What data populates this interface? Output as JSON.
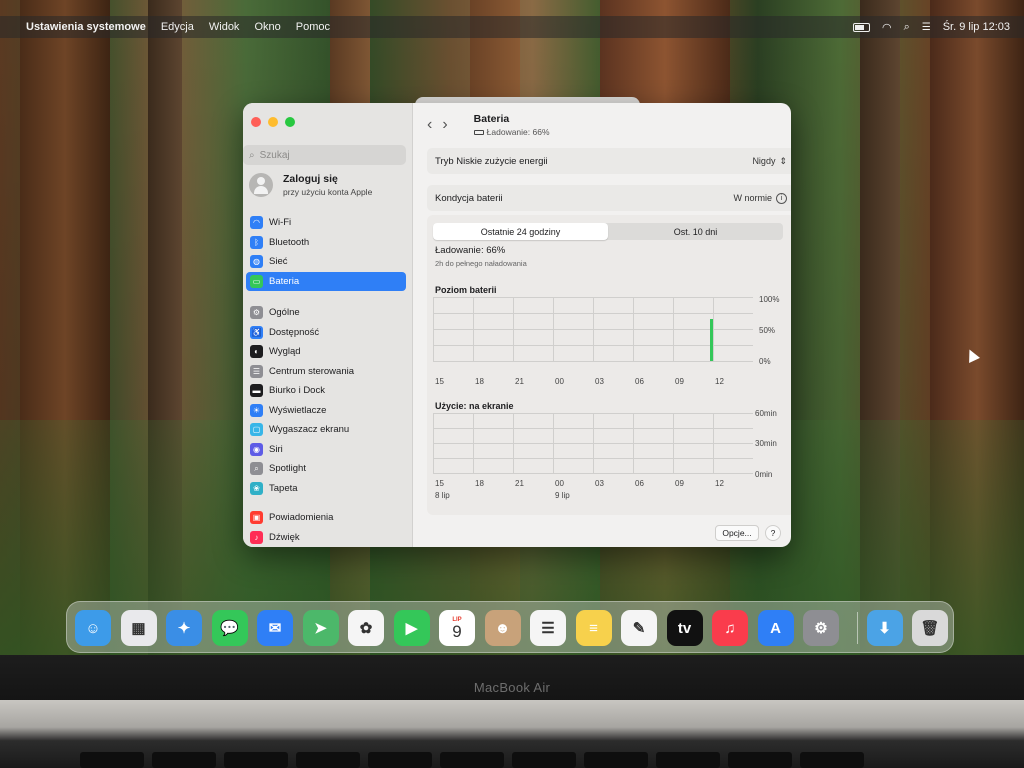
{
  "menubar": {
    "app": "Ustawienia systemowe",
    "items": [
      "Edycja",
      "Widok",
      "Okno",
      "Pomoc"
    ],
    "clock": "Śr. 9 lip  12:03"
  },
  "sidebar": {
    "search_placeholder": "Szukaj",
    "login_title": "Zaloguj się",
    "login_sub": "przy użyciu konta Apple",
    "items": [
      {
        "label": "Wi‑Fi",
        "color": "#2f7ff6",
        "icon": "wifi-icon"
      },
      {
        "label": "Bluetooth",
        "color": "#2f7ff6",
        "icon": "bluetooth-icon"
      },
      {
        "label": "Sieć",
        "color": "#2f7ff6",
        "icon": "globe-icon"
      },
      {
        "label": "Bateria",
        "color": "#34c759",
        "icon": "battery-icon"
      },
      {
        "label": "Ogólne",
        "color": "#8e8e93",
        "icon": "gear-icon"
      },
      {
        "label": "Dostępność",
        "color": "#2f7ff6",
        "icon": "accessibility-icon"
      },
      {
        "label": "Wygląd",
        "color": "#1d1d1f",
        "icon": "appearance-icon"
      },
      {
        "label": "Centrum sterowania",
        "color": "#8e8e93",
        "icon": "control-center-icon"
      },
      {
        "label": "Biurko i Dock",
        "color": "#1d1d1f",
        "icon": "dock-icon"
      },
      {
        "label": "Wyświetlacze",
        "color": "#2f7ff6",
        "icon": "sun-icon"
      },
      {
        "label": "Wygaszacz ekranu",
        "color": "#38b6e8",
        "icon": "screensaver-icon"
      },
      {
        "label": "Siri",
        "color": "#5e5ce6",
        "icon": "siri-icon"
      },
      {
        "label": "Spotlight",
        "color": "#8e8e93",
        "icon": "spotlight-icon"
      },
      {
        "label": "Tapeta",
        "color": "#30b0c7",
        "icon": "wallpaper-icon"
      },
      {
        "label": "Powiadomienia",
        "color": "#ff3b30",
        "icon": "notifications-icon"
      },
      {
        "label": "Dźwięk",
        "color": "#ff2d55",
        "icon": "sound-icon"
      }
    ],
    "active": "Bateria"
  },
  "content": {
    "title": "Bateria",
    "subtitle": "Ładowanie: 66%",
    "low_power_label": "Tryb Niskie zużycie energii",
    "low_power_value": "Nigdy",
    "health_label": "Kondycja baterii",
    "health_value": "W normie",
    "tab_24h": "Ostatnie 24 godziny",
    "tab_10d": "Ost. 10 dni",
    "charge_text": "Ładowanie: 66%",
    "charge_sub": "2h do pełnego naładowania",
    "battery_section": "Poziom baterii",
    "usage_section": "Użycie: na ekranie",
    "y_battery": [
      "100%",
      "50%",
      "0%"
    ],
    "y_usage": [
      "60min",
      "30min",
      "0min"
    ],
    "x_hours": [
      "15",
      "18",
      "21",
      "00",
      "03",
      "06",
      "09",
      "12"
    ],
    "x_days": [
      "8 lip",
      "9 lip"
    ],
    "options_button": "Opcje...",
    "help_button": "?",
    "battery_level_fraction": 0.66
  },
  "dock": {
    "apps": [
      {
        "name": "finder-icon",
        "color": "#3d9be9",
        "glyph": "☺"
      },
      {
        "name": "launchpad-icon",
        "color": "#e9e9ec",
        "glyph": "▦"
      },
      {
        "name": "safari-icon",
        "color": "#3a8ee6",
        "glyph": "✦"
      },
      {
        "name": "messages-icon",
        "color": "#34c759",
        "glyph": "💬"
      },
      {
        "name": "mail-icon",
        "color": "#2f7ff6",
        "glyph": "✉"
      },
      {
        "name": "maps-icon",
        "color": "#4cb86a",
        "glyph": "➤"
      },
      {
        "name": "photos-icon",
        "color": "#f5f5f5",
        "glyph": "✿"
      },
      {
        "name": "facetime-icon",
        "color": "#34c759",
        "glyph": "▶"
      },
      {
        "name": "calendar-icon",
        "color": "#ffffff",
        "glyph": ""
      },
      {
        "name": "contacts-icon",
        "color": "#c8a27a",
        "glyph": "☻"
      },
      {
        "name": "reminders-icon",
        "color": "#f5f5f5",
        "glyph": "☰"
      },
      {
        "name": "notes-icon",
        "color": "#f7d14c",
        "glyph": "≡"
      },
      {
        "name": "freeform-icon",
        "color": "#f5f5f5",
        "glyph": "✎"
      },
      {
        "name": "appletv-icon",
        "color": "#111111",
        "glyph": "tv"
      },
      {
        "name": "music-icon",
        "color": "#fa3c4c",
        "glyph": "♫"
      },
      {
        "name": "appstore-icon",
        "color": "#2f7ff6",
        "glyph": "A"
      },
      {
        "name": "system-settings-icon",
        "color": "#8e8e93",
        "glyph": "⚙"
      },
      {
        "name": "downloads-icon",
        "color": "#4ba3e6",
        "glyph": "⬇"
      },
      {
        "name": "trash-icon",
        "color": "#d9d9d9",
        "glyph": "🗑"
      }
    ],
    "calendar_month": "LIP",
    "calendar_day": "9"
  },
  "device": {
    "brand": "MacBook Air"
  }
}
